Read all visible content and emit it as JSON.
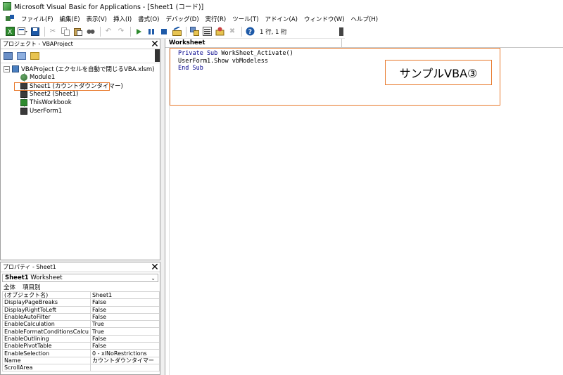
{
  "window": {
    "title": "Microsoft Visual Basic for Applications - [Sheet1 (コード)]"
  },
  "menubar": {
    "items": [
      "ファイル(F)",
      "編集(E)",
      "表示(V)",
      "挿入(I)",
      "書式(O)",
      "デバッグ(D)",
      "実行(R)",
      "ツール(T)",
      "アドイン(A)",
      "ウィンドウ(W)",
      "ヘルプ(H)"
    ]
  },
  "toolbar": {
    "position": "1 行, 1 桁"
  },
  "project": {
    "header": "プロジェクト - VBAProject",
    "root": "VBAProject (エクセルを自動で閉じるVBA.xlsm)",
    "expander": "−",
    "items": [
      {
        "label": "Module1",
        "icon": "module-icon"
      },
      {
        "label": "Sheet1 (カウントダウンタイマー)",
        "icon": "sheet-icon"
      },
      {
        "label": "Sheet2 (Sheet1)",
        "icon": "sheet-icon"
      },
      {
        "label": "ThisWorkbook",
        "icon": "workbook-icon"
      },
      {
        "label": "UserForm1",
        "icon": "form-icon"
      }
    ]
  },
  "properties": {
    "header": "プロパティ - Sheet1",
    "selector_bold": "Sheet1",
    "selector_type": "Worksheet",
    "tabs": [
      "全体",
      "項目別"
    ],
    "rows": [
      {
        "key": "(オブジェクト名)",
        "value": "Sheet1"
      },
      {
        "key": "DisplayPageBreaks",
        "value": "False"
      },
      {
        "key": "DisplayRightToLeft",
        "value": "False"
      },
      {
        "key": "EnableAutoFilter",
        "value": "False"
      },
      {
        "key": "EnableCalculation",
        "value": "True"
      },
      {
        "key": "EnableFormatConditionsCalcu",
        "value": "True"
      },
      {
        "key": "EnableOutlining",
        "value": "False"
      },
      {
        "key": "EnablePivotTable",
        "value": "False"
      },
      {
        "key": "EnableSelection",
        "value": "0 - xlNoRestrictions"
      },
      {
        "key": "Name",
        "value": "カウントダウンタイマー"
      },
      {
        "key": "ScrollArea",
        "value": ""
      }
    ]
  },
  "code": {
    "object_dropdown": "Worksheet",
    "lines": [
      {
        "kw1": "Private Sub",
        "rest": " WorkSheet_Activate()",
        "kw2": ""
      },
      {
        "kw1": "",
        "rest": "UserForm1.Show vbModeless",
        "kw2": ""
      },
      {
        "kw1": "End Sub",
        "rest": "",
        "kw2": ""
      }
    ],
    "annotation": "サンプルVBA③"
  },
  "colors": {
    "highlight": "#e8782a",
    "keyword": "#00008b"
  }
}
